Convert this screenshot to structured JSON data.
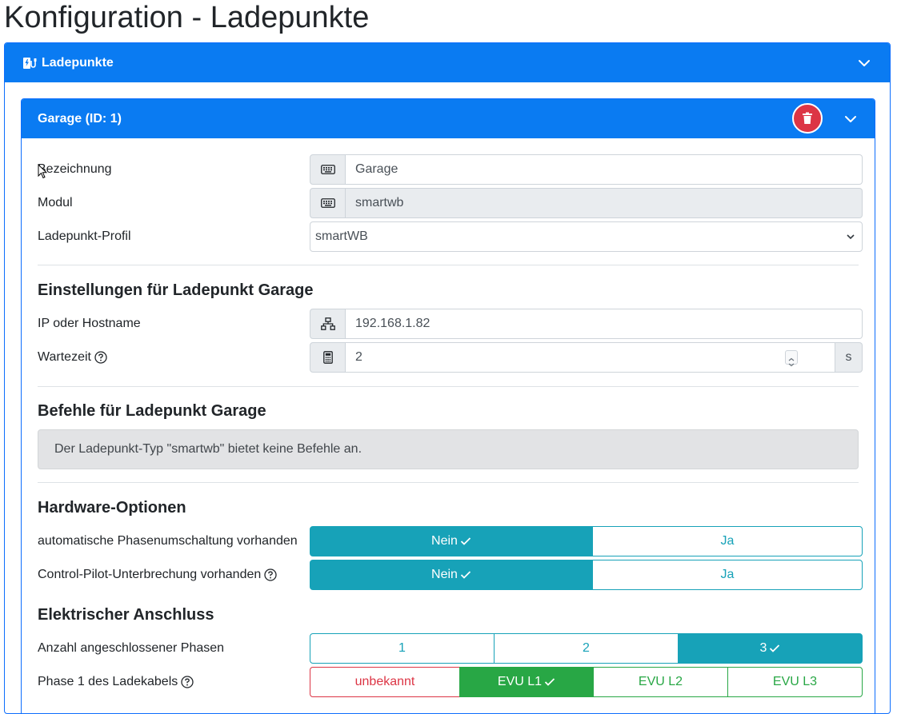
{
  "page_title": "Konfiguration - Ladepunkte",
  "outer_card": {
    "title": "Ladepunkte",
    "icon": "charging-station-icon"
  },
  "inner_card": {
    "title": "Garage (ID: 1)"
  },
  "fields": {
    "bezeichnung": {
      "label": "Bezeichnung",
      "value": "Garage",
      "icon": "keyboard-icon"
    },
    "modul": {
      "label": "Modul",
      "value": "smartwb",
      "icon": "keyboard-icon"
    },
    "profil": {
      "label": "Ladepunkt-Profil",
      "value": "smartWB"
    }
  },
  "settings": {
    "title": "Einstellungen für Ladepunkt Garage",
    "ip": {
      "label": "IP oder Hostname",
      "value": "192.168.1.82",
      "icon": "network-icon"
    },
    "wartezeit": {
      "label": "Wartezeit",
      "value": "2",
      "unit": "s",
      "icon": "calculator-icon"
    }
  },
  "commands": {
    "title": "Befehle für Ladepunkt Garage",
    "info": "Der Ladepunkt-Typ \"smartwb\" bietet keine Befehle an."
  },
  "hardware": {
    "title": "Hardware-Optionen",
    "phase_switch": {
      "label": "automatische Phasenumschaltung vorhanden",
      "options": [
        "Nein",
        "Ja"
      ],
      "selected": "Nein"
    },
    "cp_interrupt": {
      "label": "Control-Pilot-Unterbrechung vorhanden",
      "options": [
        "Nein",
        "Ja"
      ],
      "selected": "Nein"
    }
  },
  "electrical": {
    "title": "Elektrischer Anschluss",
    "phases": {
      "label": "Anzahl angeschlossener Phasen",
      "options": [
        "1",
        "2",
        "3"
      ],
      "selected": "3"
    },
    "phase1": {
      "label": "Phase 1 des Ladekabels",
      "options": [
        "unbekannt",
        "EVU L1",
        "EVU L2",
        "EVU L3"
      ],
      "selected": "EVU L1"
    }
  },
  "colors": {
    "primary": "#0a7bf2",
    "info": "#17a2b8",
    "success": "#28a745",
    "danger": "#dc3545"
  }
}
